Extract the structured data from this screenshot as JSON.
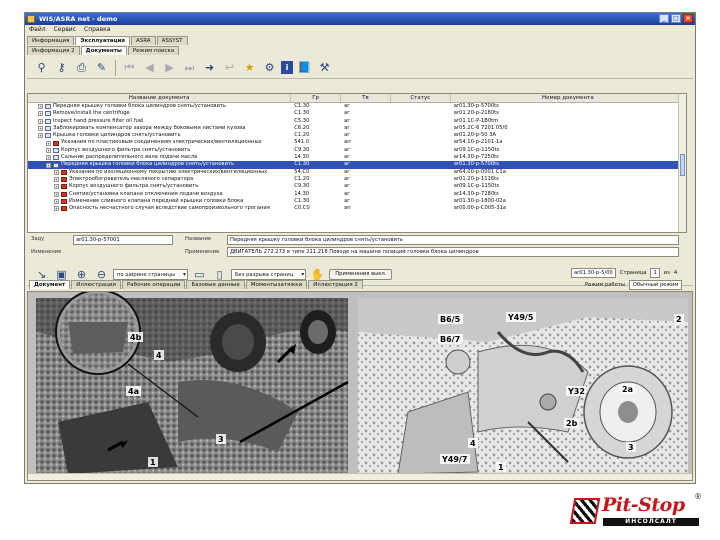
{
  "window": {
    "title": "WIS/ASRA net - demo",
    "controls": [
      "_",
      "□",
      "×"
    ]
  },
  "menu": [
    "Файл",
    "Сервис",
    "Справка"
  ],
  "main_tabs": [
    {
      "label": "Информация",
      "active": false
    },
    {
      "label": "Эксплуатация",
      "active": true
    },
    {
      "label": "ASRA",
      "active": false
    },
    {
      "label": "ASSYST",
      "active": false
    }
  ],
  "sub_tabs": [
    {
      "label": "Информация 2",
      "active": false
    },
    {
      "label": "Документы",
      "active": true
    },
    {
      "label": "Режим поиска",
      "active": false
    }
  ],
  "toolbar_icons": [
    "binoculars-icon",
    "key-icon",
    "print-icon",
    "edit-icon",
    "first-icon",
    "prev-icon",
    "next-icon",
    "last-icon",
    "forward-icon",
    "back-icon",
    "star-icon",
    "wrench-icon",
    "info-icon",
    "book-icon",
    "tools-icon"
  ],
  "table": {
    "headers": [
      "Название документа",
      "Гр",
      "Тв",
      "Статус",
      "Номер документа"
    ],
    "rows": [
      {
        "name": "Передняя крышку головки блока цилиндров снять/установить",
        "gr": "C1.30",
        "tv": "аг",
        "status": "",
        "num": "ar01.30-p-5700ts",
        "level": 0,
        "icon": "folder"
      },
      {
        "name": "Remove/install the centrifuge",
        "gr": "C1.30",
        "tv": "аг",
        "status": "",
        "num": "ar01.20-p-2180ts",
        "level": 0,
        "icon": "folder"
      },
      {
        "name": "Inspect hand pressure filter oil fuel",
        "gr": "C5.30",
        "tv": "аг",
        "status": "",
        "num": "ar01.1C-P-1B0tm",
        "level": 0,
        "icon": "folder"
      },
      {
        "name": "Заблокировать компенсатор зазора между боковыми листами кузова",
        "gr": "C6.20",
        "tv": "аг",
        "status": "",
        "num": "ar05.2C-6 7201 05/0",
        "level": 0,
        "icon": "folder"
      },
      {
        "name": "Крышка головки цилиндров снять/установить",
        "gr": "C1.20",
        "tv": "аг",
        "status": "",
        "num": "ar01.20-p-50 3A",
        "level": 0,
        "icon": "folder"
      },
      {
        "name": "Указания по пластиковым соединениям электрических/вентиляционных",
        "gr": "541.0",
        "tv": "ап",
        "status": "",
        "num": "ar54.10-p-2101-1a",
        "level": 1,
        "icon": "doc"
      },
      {
        "name": "Корпус воздушного фильтра снять/установить",
        "gr": "C9.30",
        "tv": "аг",
        "status": "",
        "num": "ar09.1C-p-1150ts",
        "level": 1,
        "icon": "folder"
      },
      {
        "name": "Сальник распределительного вала подачи масла",
        "gr": "14.30",
        "tv": "аг",
        "status": "",
        "num": "ar14.30-p-7250ts",
        "level": 1,
        "icon": "folder"
      },
      {
        "name": "Передняя крышка головки блока цилиндров снять/установить",
        "gr": "C1.30",
        "tv": "аг",
        "status": "",
        "num": "ar01.30-p-5700ts",
        "level": 1,
        "icon": "folder",
        "selected": true
      },
      {
        "name": "Указания по изоляционному покрытию электрических/вентиляционных",
        "gr": "54.C0",
        "tv": "аг",
        "status": "",
        "num": "ar64.00-p-0001 C1a",
        "level": 2,
        "icon": "doc"
      },
      {
        "name": "Электрообогреватель масляного сепаратора",
        "gr": "C1.20",
        "tv": "аг",
        "status": "",
        "num": "ar01.20-p-1116ts",
        "level": 2,
        "icon": "doc"
      },
      {
        "name": "Корпус воздушного фильтра снять/установить",
        "gr": "C9.30",
        "tv": "аг",
        "status": "",
        "num": "ar09.1C-p-1150ts",
        "level": 2,
        "icon": "doc"
      },
      {
        "name": "Снятие/установка клапана отключения подачи воздуха",
        "gr": "14.30",
        "tv": "аг",
        "status": "",
        "num": "ar14.30-p-7280ts",
        "level": 2,
        "icon": "doc"
      },
      {
        "name": "Изменение сливного клапана передней крышки головки блока",
        "gr": "C1.30",
        "tv": "аг",
        "status": "",
        "num": "ar01.30-p-1800-02a",
        "level": 2,
        "icon": "doc"
      },
      {
        "name": "Опасность несчастного случая вследствие самопроизвольного трогания",
        "gr": "C0.C0",
        "tv": "ап",
        "status": "",
        "num": "ar00.00-p-C005-31a",
        "level": 2,
        "icon": "doc"
      }
    ]
  },
  "details": {
    "doc_label": "Заду",
    "doc_value": "ar01.30-p-57001",
    "title_label": "Название",
    "title_value": "Передняя крышку головки блока цилиндров снять/установить",
    "change_label": "Изменение",
    "apply_label": "Применение",
    "apply_value": "ДВИГАТЕЛЬ 272.273 в типе 211.218 Поводе на машине позиций головки блока цилиндров"
  },
  "viewer_toolbar": {
    "zoom_label": "по ширине страницы",
    "layout_label": "Без разрыва страниц",
    "apply_button": "Применения выкл.",
    "doc_code": "ar01.30-p-5/00",
    "page_label": "Страница",
    "page_value": "1",
    "page_of": "из",
    "page_total": "4",
    "mode_label": "Режим работы",
    "mode_value": "Обычный режим"
  },
  "viewer_tabs": [
    {
      "label": "Документ",
      "active": true
    },
    {
      "label": "Иллюстрации",
      "active": false
    },
    {
      "label": "Рабочие операции",
      "active": false
    },
    {
      "label": "Базовые данные",
      "active": false
    },
    {
      "label": "Моментызатяжки",
      "active": false
    },
    {
      "label": "Иллюстрация 2",
      "active": false
    }
  ],
  "illustration_left": {
    "callouts": [
      "4b",
      "4",
      "4a",
      "3",
      "1"
    ]
  },
  "illustration_right": {
    "callouts": [
      "B6/5",
      "B6/7",
      "Y49/5",
      "2",
      "Y32",
      "2a",
      "2b",
      "4",
      "3",
      "Y49/7",
      "1"
    ]
  },
  "logo": {
    "name": "Pit-Stop",
    "sub": "ИНСОЛСАЛТ",
    "reg": "®"
  },
  "colors": {
    "selection": "#2f52b3",
    "title_bar": "#1c3f9a",
    "logo_red": "#c4161c"
  }
}
